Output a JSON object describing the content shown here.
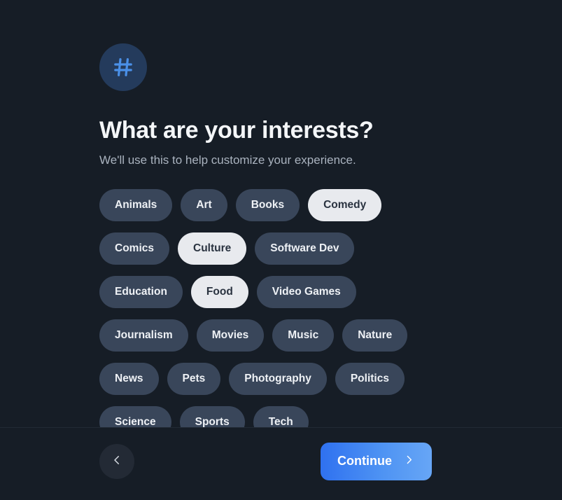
{
  "theme": {
    "background": "#161d26",
    "chip_unselected_bg": "#39465a",
    "chip_unselected_text": "#eef1f5",
    "chip_selected_bg": "#e8eaee",
    "chip_selected_text": "#2a3340",
    "accent_gradient_start": "#2f71f0",
    "accent_gradient_end": "#67a6f6",
    "logo_badge_bg": "#243b5c",
    "logo_glyph": "#4a90e8",
    "divider": "#222a35"
  },
  "header": {
    "logo_icon": "hash-icon",
    "title": "What are your interests?",
    "subtitle": "We'll use this to help customize your experience."
  },
  "interests": [
    {
      "label": "Animals",
      "selected": false
    },
    {
      "label": "Art",
      "selected": false
    },
    {
      "label": "Books",
      "selected": false
    },
    {
      "label": "Comedy",
      "selected": true
    },
    {
      "label": "Comics",
      "selected": false
    },
    {
      "label": "Culture",
      "selected": true
    },
    {
      "label": "Software Dev",
      "selected": false
    },
    {
      "label": "Education",
      "selected": false
    },
    {
      "label": "Food",
      "selected": true
    },
    {
      "label": "Video Games",
      "selected": false
    },
    {
      "label": "Journalism",
      "selected": false
    },
    {
      "label": "Movies",
      "selected": false
    },
    {
      "label": "Music",
      "selected": false
    },
    {
      "label": "Nature",
      "selected": false
    },
    {
      "label": "News",
      "selected": false
    },
    {
      "label": "Pets",
      "selected": false
    },
    {
      "label": "Photography",
      "selected": false
    },
    {
      "label": "Politics",
      "selected": false
    },
    {
      "label": "Science",
      "selected": false
    },
    {
      "label": "Sports",
      "selected": false
    },
    {
      "label": "Tech",
      "selected": false
    }
  ],
  "footer": {
    "back_icon": "chevron-left-icon",
    "continue_label": "Continue",
    "continue_icon": "chevron-right-icon"
  }
}
